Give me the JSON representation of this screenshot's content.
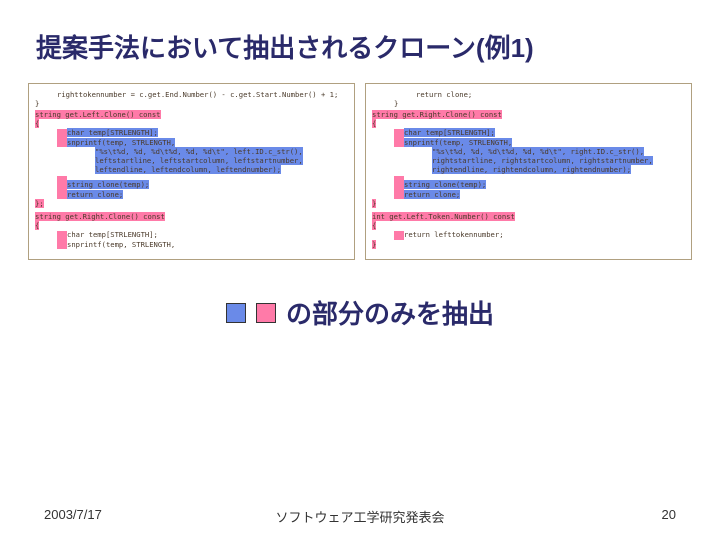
{
  "title": "提案手法において抽出されるクローン(例1)",
  "legend_text": "の部分のみを抽出",
  "footer": {
    "date": "2003/7/17",
    "venue": "ソフトウェア工学研究発表会",
    "page": "20"
  },
  "left": {
    "l1": "righttokennumber = c.get.End.Number() - c.get.Start.Number() + 1;",
    "l2": "}",
    "fn1a": "string get.Left.Clone() const",
    "fn1b": "{",
    "b1": "char temp[STRLENGTH];",
    "b2": "snprintf(temp, STRLENGTH,",
    "b3": "\"%s\\t%d, %d, %d\\t%d, %d, %d\\t\", left.ID.c_str(),",
    "b4": "leftstartline, leftstartcolumn, leftstartnumber,",
    "b5": "leftendline, leftendcolumn, leftendnumber);",
    "b6": "string clone(temp);",
    "b7": "return clone;",
    "fn1c": "};",
    "fn2a": "string get.Right.Clone() const",
    "fn2b": "{",
    "c1": "char temp[STRLENGTH];",
    "c2": "snprintf(temp, STRLENGTH,"
  },
  "right": {
    "r1": "return clone;",
    "r2": "}",
    "fn1a": "string get.Right.Clone() const",
    "fn1b": "{",
    "b1": "char temp[STRLENGTH];",
    "b2": "snprintf(temp, STRLENGTH,",
    "b3": "\"%s\\t%d, %d, %d\\t%d, %d, %d\\t\", right.ID.c_str(),",
    "b4": "rightstartline, rightstartcolumn, rightstartnumber,",
    "b5": "rightendline, rightendcolumn, rightendnumber);",
    "b6": "string clone(temp);",
    "b7": "return clone;",
    "fn1c": "}",
    "fn2a": "int get.Left.Token.Number() const",
    "fn2b": "{",
    "c1": "return lefttokennumber;",
    "fn2c": "}"
  },
  "colors": {
    "pink": "#ff7aa8",
    "blue": "#6a8ae8"
  }
}
